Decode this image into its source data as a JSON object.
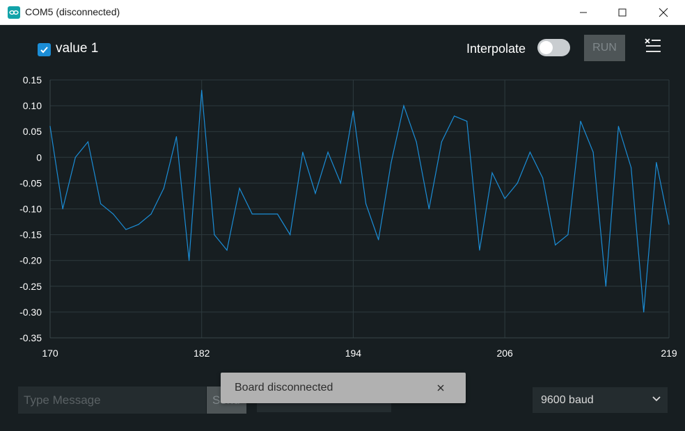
{
  "window": {
    "title": "COM5 (disconnected)",
    "app_icon": "arduino-infinity-icon",
    "controls": [
      "minimize-icon",
      "maximize-icon",
      "close-icon"
    ]
  },
  "toolbar": {
    "series_checkbox_checked": true,
    "series_label": "value 1",
    "interpolate_label": "Interpolate",
    "interpolate_on": false,
    "run_label": "RUN",
    "menu_icon": "clear-list-icon"
  },
  "chart_data": {
    "type": "line",
    "xlim": [
      170,
      219
    ],
    "ylim": [
      -0.35,
      0.15
    ],
    "x_ticks": [
      "170",
      "182",
      "194",
      "206",
      "219"
    ],
    "y_ticks": [
      "0.15",
      "0.10",
      "0.05",
      "0",
      "-0.05",
      "-0.10",
      "-0.15",
      "-0.20",
      "-0.25",
      "-0.30",
      "-0.35"
    ],
    "grid": true,
    "series": [
      {
        "color": "#1b8dd6",
        "x": [
          170,
          171,
          172,
          173,
          174,
          175,
          176,
          177,
          178,
          179,
          180,
          181,
          182,
          183,
          184,
          185,
          186,
          187,
          188,
          189,
          190,
          191,
          192,
          193,
          194,
          195,
          196,
          197,
          198,
          199,
          200,
          201,
          202,
          203,
          204,
          205,
          206,
          207,
          208,
          209,
          210,
          211,
          212,
          213,
          214,
          215,
          216,
          217,
          218,
          219
        ],
        "values": [
          0.06,
          -0.1,
          0.0,
          0.03,
          -0.09,
          -0.11,
          -0.14,
          -0.13,
          -0.11,
          -0.06,
          0.04,
          -0.2,
          0.13,
          -0.15,
          -0.18,
          -0.06,
          -0.11,
          -0.11,
          -0.11,
          -0.15,
          0.01,
          -0.07,
          0.01,
          -0.05,
          0.09,
          -0.09,
          -0.16,
          -0.01,
          0.1,
          0.03,
          -0.1,
          0.03,
          0.08,
          0.07,
          -0.18,
          -0.03,
          -0.08,
          -0.05,
          0.01,
          -0.04,
          -0.17,
          -0.15,
          0.07,
          0.01,
          -0.25,
          0.06,
          -0.02,
          -0.3,
          -0.01,
          -0.13
        ]
      }
    ]
  },
  "footer": {
    "message_placeholder": "Type Message",
    "send_label": "Send",
    "line_ending": "",
    "baud_value": "9600 baud"
  },
  "toast": {
    "text": "Board disconnected"
  }
}
